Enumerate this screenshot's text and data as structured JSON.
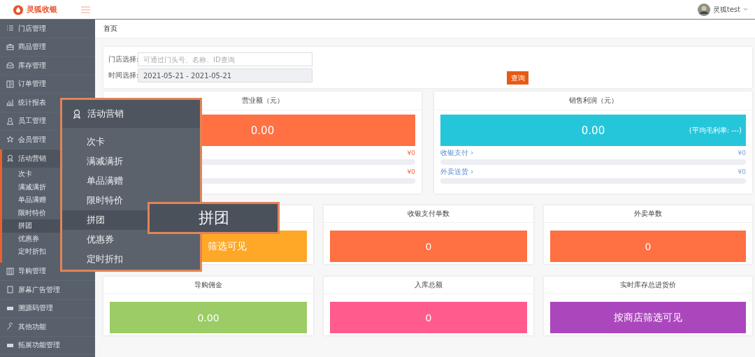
{
  "header": {
    "logo_text": "灵狐收银",
    "user": "灵狐test"
  },
  "sidebar": {
    "items": [
      {
        "label": "门店管理",
        "expanded": false
      },
      {
        "label": "商品管理",
        "expanded": false
      },
      {
        "label": "库存管理",
        "expanded": false
      },
      {
        "label": "订单管理",
        "expanded": false
      },
      {
        "label": "统计报表",
        "expanded": false
      },
      {
        "label": "员工管理",
        "expanded": false
      },
      {
        "label": "会员管理",
        "expanded": false
      },
      {
        "label": "活动营销",
        "expanded": true,
        "children": [
          {
            "label": "次卡",
            "selected": false
          },
          {
            "label": "满减满折",
            "selected": false
          },
          {
            "label": "单品满赠",
            "selected": false
          },
          {
            "label": "限时特价",
            "selected": false
          },
          {
            "label": "拼团",
            "selected": true
          },
          {
            "label": "优惠券",
            "selected": false
          },
          {
            "label": "定时折扣",
            "selected": false
          }
        ]
      },
      {
        "label": "导购管理",
        "expanded": false
      },
      {
        "label": "屏幕广告管理",
        "expanded": false
      },
      {
        "label": "溯源码管理",
        "expanded": false
      },
      {
        "label": "其他功能",
        "expanded": false
      },
      {
        "label": "拓展功能管理",
        "expanded": false
      }
    ]
  },
  "breadcrumb": "首页",
  "filters": [
    {
      "label": "门店选择:",
      "placeholder": "可通过门头号、名称、ID查询",
      "disabled": false
    },
    {
      "label": "时间选择:",
      "value": "2021-05-21 - 2021-05-21",
      "disabled": true
    }
  ],
  "query_button": "查询",
  "summary_cards": [
    {
      "title": "营业额（元）",
      "value": "0.00",
      "color": "#ff7043",
      "rows": [
        {
          "amount": "¥0",
          "level": 0
        },
        {
          "amount": "¥0",
          "level": 0
        }
      ]
    },
    {
      "title": "销售利润（元）",
      "value": "0.00",
      "note": "(平均毛利率: ---)",
      "color": "#26c6da",
      "rows": [
        {
          "label": "收银支付 ›",
          "amount": "¥0",
          "level": 0
        },
        {
          "label": "外卖送货 ›",
          "amount": "¥0",
          "level": 0
        }
      ]
    }
  ],
  "stat_cards": [
    {
      "value": "筛选可见",
      "color": "#ffa726"
    },
    {
      "title": "收银支付单数",
      "value": "0",
      "color": "#ff7043"
    },
    {
      "title": "外卖单数",
      "value": "0",
      "color": "#ff7043"
    },
    {
      "title": "导购佣金",
      "value": "0.00",
      "color": "#9ccc65"
    },
    {
      "title": "入库总额",
      "value": "0",
      "color": "#ff5c8d"
    },
    {
      "title": "实时库存总进货价",
      "value": "按商店筛选可见",
      "color": "#ab47bc"
    }
  ],
  "popup": {
    "title": "活动营销",
    "items": [
      {
        "label": "次卡",
        "selected": false
      },
      {
        "label": "满减满折",
        "selected": false
      },
      {
        "label": "单品满赠",
        "selected": false
      },
      {
        "label": "限时特价",
        "selected": false
      },
      {
        "label": "拼团",
        "selected": true
      },
      {
        "label": "优惠券",
        "selected": false
      },
      {
        "label": "定时折扣",
        "selected": false
      }
    ]
  },
  "callout": {
    "label": "拼团"
  }
}
